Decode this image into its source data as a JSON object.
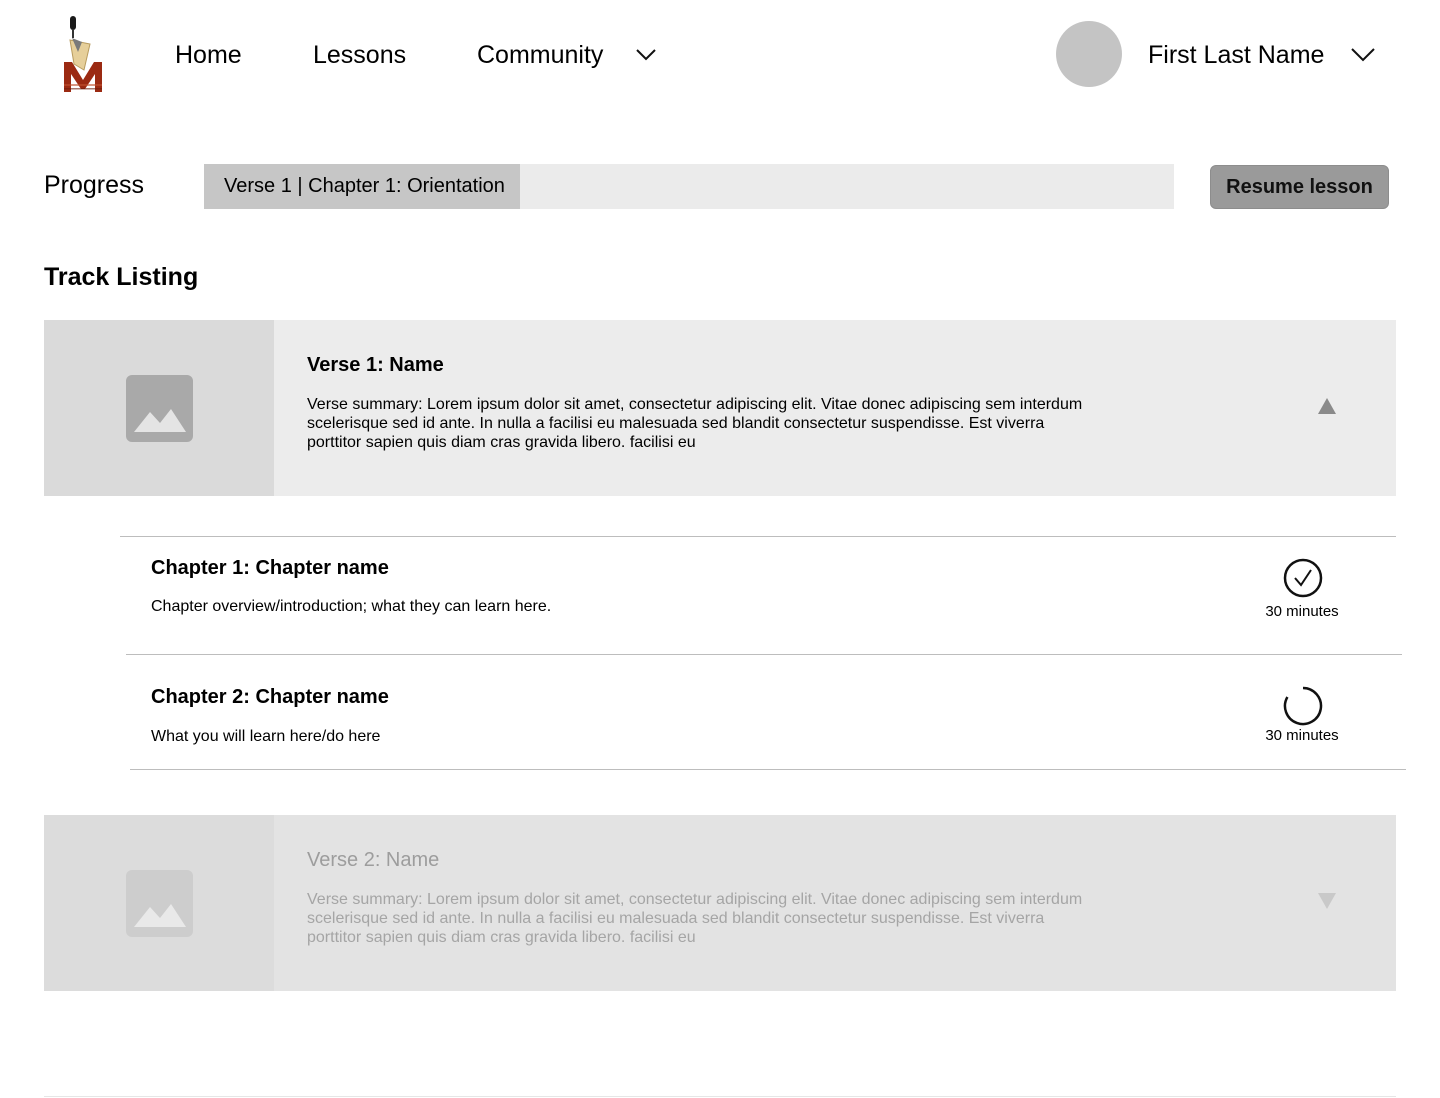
{
  "header": {
    "logo_icon": "microphone-m-logo-icon",
    "nav": {
      "home": "Home",
      "lessons": "Lessons",
      "community": "Community"
    },
    "user_name": "First Last Name"
  },
  "progress": {
    "label": "Progress",
    "current": "Verse 1 | Chapter 1: Orientation",
    "fraction": 0.326,
    "resume_label": "Resume lesson"
  },
  "track_listing": {
    "title": "Track Listing",
    "verses": [
      {
        "title": "Verse 1: Name",
        "summary": "Verse summary: Lorem ipsum dolor sit amet, consectetur adipiscing elit. Vitae donec adipiscing sem interdum scelerisque sed id ante. In nulla a facilisi eu malesuada sed blandit consectetur suspendisse. Est viverra porttitor sapien quis diam cras gravida libero. facilisi eu",
        "expanded": true,
        "chapters": [
          {
            "title": "Chapter 1: Chapter name",
            "description": "Chapter overview/introduction; what they can learn here.",
            "duration": "30 minutes",
            "status": "completed"
          },
          {
            "title": "Chapter 2: Chapter name",
            "description": "What you will learn here/do here",
            "duration": "30 minutes",
            "status": "in-progress"
          }
        ]
      },
      {
        "title": "Verse 2: Name",
        "summary": "Verse summary: Lorem ipsum dolor sit amet, consectetur adipiscing elit. Vitae donec adipiscing sem interdum scelerisque sed id ante. In nulla a facilisi eu malesuada sed blandit consectetur suspendisse. Est viverra porttitor sapien quis diam cras gravida libero. facilisi eu",
        "expanded": false
      }
    ]
  },
  "colors": {
    "progress_track": "#ebebeb",
    "progress_fill": "#c6c6c6",
    "resume_button": "#9a9a9a",
    "verse_active_bg": "#ececec",
    "verse_locked_bg": "#e3e3e3",
    "logo_red": "#9b2a12"
  }
}
